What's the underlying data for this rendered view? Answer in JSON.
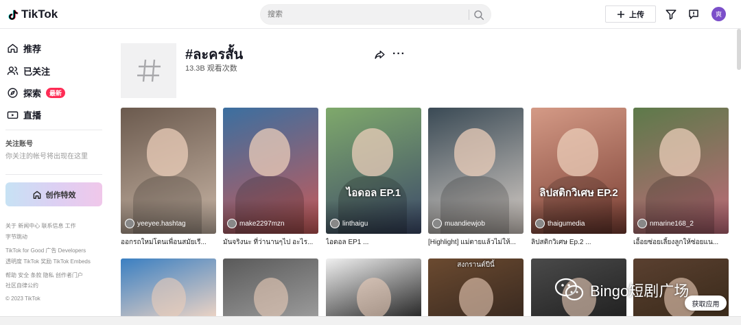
{
  "app": {
    "logo_text": "TikTok"
  },
  "search": {
    "placeholder": "搜索"
  },
  "header": {
    "upload_label": "上传",
    "avatar_letter": "爽"
  },
  "sidebar": {
    "items": [
      {
        "label": "推荐",
        "icon": "home-icon"
      },
      {
        "label": "已关注",
        "icon": "users-icon"
      },
      {
        "label": "探索",
        "icon": "compass-icon",
        "badge": "最新"
      },
      {
        "label": "直播",
        "icon": "live-icon"
      }
    ],
    "follow_title": "关注账号",
    "follow_empty": "你关注的帐号将出现在这里",
    "effects_label": "创作特效",
    "footer": [
      "关于  新闻中心  联系信息  工作",
      "字节跳动",
      "TikTok for Good  广告  Developers",
      "透明度  TikTok 奖励  TikTok Embeds",
      "帮助  安全  条款  隐私  创作者门户",
      "社区自律公约",
      "© 2023 TikTok"
    ]
  },
  "hashtag": {
    "title": "#ละครสั้น",
    "views": "13.3B 观看次数"
  },
  "videos": [
    {
      "user": "yeeyee.hashtag",
      "caption": "ออกรถใหม่โดนเพื่อนสมัยเรี...",
      "bg1": "#6b5a4e",
      "bg2": "#c9b6a6"
    },
    {
      "user": "make2297mzn",
      "caption": "มันจริงนะ ที่ว่านานๆไป อะไร...",
      "bg1": "#3b6fa0",
      "bg2": "#c95a58"
    },
    {
      "user": "linthaigu",
      "caption": "ไอดอล EP1 ...",
      "bg1": "#7fa96b",
      "bg2": "#3c4a6a",
      "overlay": "ไอดอล EP.1"
    },
    {
      "user": "muandiewjob",
      "caption": "[Highlight] แม่ตายแล้วไม่ให้...",
      "bg1": "#3a4a55",
      "bg2": "#d8cfc8"
    },
    {
      "user": "thaigumedia",
      "caption": "ลิปสติกวิเศษ Ep.2 ...",
      "bg1": "#d49a86",
      "bg2": "#7a3e33",
      "overlay": "ลิปสติกวิเศษ EP.2"
    },
    {
      "user": "nmarine168_2",
      "caption": "เอื้อยซ่อยเลี้ยงลูกให้ซ่อยแน...",
      "bg1": "#5d7a4a",
      "bg2": "#c06a7a"
    }
  ],
  "row2": [
    {
      "bg1": "#3a7fc2",
      "bg2": "#e9d2c4"
    },
    {
      "bg1": "#5a5a5a",
      "bg2": "#9a9a9a"
    },
    {
      "bg1": "#f0f0f0",
      "bg2": "#2a2a2a"
    },
    {
      "bg1": "#6b4a30",
      "bg2": "#3a2a20",
      "overlay": "สงกรานต์ปีนี้"
    },
    {
      "bg1": "#4a4a4a",
      "bg2": "#222222"
    },
    {
      "bg1": "#5a4030",
      "bg2": "#3a2a1a"
    }
  ],
  "watermark": {
    "text": "Bingo短剧广场"
  },
  "get_app_label": "获取应用",
  "colors": {
    "accent": "#fe2c55",
    "avatar": "#7b4fc9"
  }
}
